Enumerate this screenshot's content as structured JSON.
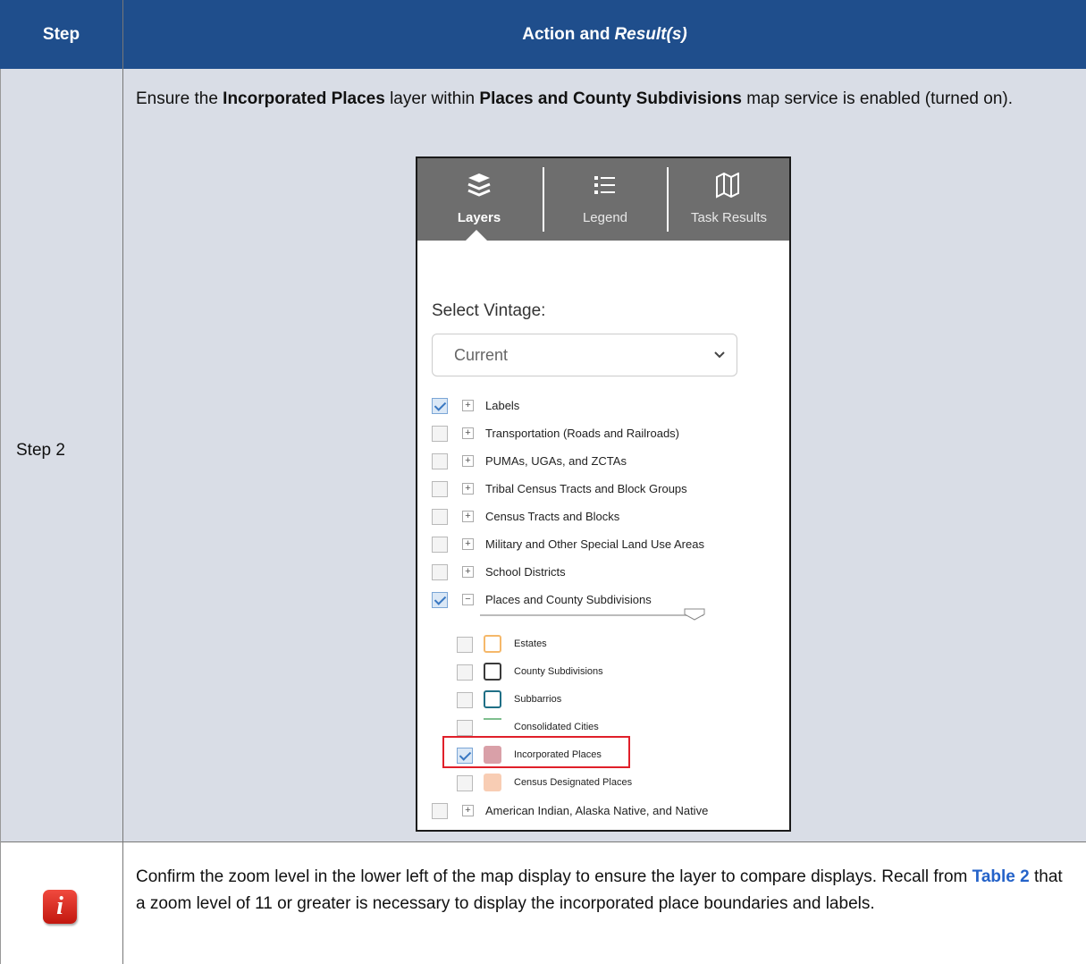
{
  "table": {
    "header_step": "Step",
    "header_action": "Action and ",
    "header_result": "Result(s)",
    "step_label": "Step 2",
    "intro": {
      "t1": "Ensure the ",
      "b1": "Incorporated Places",
      "t2": " layer within ",
      "b2": "Places and County Subdivisions",
      "t3": " map service is enabled (turned on)."
    },
    "note": {
      "t1": "Confirm the zoom level in the lower left of the map display to ensure the layer to compare displays. Recall from ",
      "link": "Table 2",
      "t2": " that a zoom level of 11 or greater is necessary to display the incorporated place boundaries and labels."
    },
    "note_icon": "i"
  },
  "panel": {
    "tabs": [
      {
        "label": "Layers",
        "icon": "layers-icon",
        "active": true
      },
      {
        "label": "Legend",
        "icon": "list-icon",
        "active": false
      },
      {
        "label": "Task Results",
        "icon": "map-icon",
        "active": false
      }
    ],
    "vintage_label": "Select Vintage:",
    "vintage_value": "Current",
    "layers": [
      {
        "label": "Labels",
        "checked": true,
        "expand": "+"
      },
      {
        "label": "Transportation (Roads and Railroads)",
        "checked": false,
        "expand": "+"
      },
      {
        "label": "PUMAs, UGAs, and ZCTAs",
        "checked": false,
        "expand": "+"
      },
      {
        "label": "Tribal Census Tracts and Block Groups",
        "checked": false,
        "expand": "+"
      },
      {
        "label": "Census Tracts and Blocks",
        "checked": false,
        "expand": "+"
      },
      {
        "label": "Military and Other Special Land Use Areas",
        "checked": false,
        "expand": "+"
      },
      {
        "label": "School Districts",
        "checked": false,
        "expand": "+"
      },
      {
        "label": "Places and County Subdivisions",
        "checked": true,
        "expand": "−"
      }
    ],
    "sublayers": [
      {
        "label": "Estates",
        "checked": false,
        "swatch": "orange-outline",
        "color": "#f5b86a"
      },
      {
        "label": "County Subdivisions",
        "checked": false,
        "swatch": "dark-outline",
        "color": "#3a3a3a"
      },
      {
        "label": "Subbarrios",
        "checked": false,
        "swatch": "teal-outline",
        "color": "#1f6f86"
      },
      {
        "label": "Consolidated Cities",
        "checked": false,
        "swatch": "green-line",
        "color": "#7fbf8f"
      },
      {
        "label": "Incorporated Places",
        "checked": true,
        "swatch": "pink-fill",
        "color": "#d9a0a8"
      },
      {
        "label": "Census Designated Places",
        "checked": false,
        "swatch": "peach-fill",
        "color": "#f8cdb4"
      }
    ],
    "last_layer": {
      "label": "American Indian, Alaska Native, and Native",
      "checked": false,
      "expand": "+"
    },
    "highlight_color": "#e0202a"
  }
}
